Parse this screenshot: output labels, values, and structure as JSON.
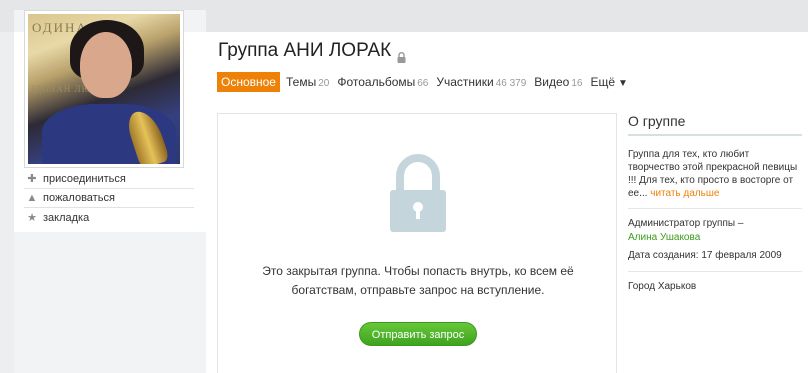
{
  "group": {
    "title": "Группа АНИ ЛОРАК",
    "avatar_banner": "ОДИНА",
    "avatar_banner2": "ЗДОЛАН        ЛЮД"
  },
  "sidebar": {
    "actions": [
      {
        "label": "присоединиться",
        "icon": "plus-icon"
      },
      {
        "label": "пожаловаться",
        "icon": "warning-icon"
      },
      {
        "label": "закладка",
        "icon": "star-icon"
      }
    ]
  },
  "tabs": [
    {
      "label": "Основное",
      "count": "",
      "active": true
    },
    {
      "label": "Темы",
      "count": "20"
    },
    {
      "label": "Фотоальбомы",
      "count": "66"
    },
    {
      "label": "Участники",
      "count": "46 379"
    },
    {
      "label": "Видео",
      "count": "16"
    },
    {
      "label": "Ещё",
      "count": ""
    }
  ],
  "locked": {
    "line1": "Это закрытая группа. Чтобы попасть внутрь, ко всем её",
    "line2": "богатствам, отправьте запрос на вступление.",
    "button": "Отправить запрос"
  },
  "about": {
    "title": "О группе",
    "description": "Группа для тех, кто любит творчество этой прекрасной певицы !!! Для тех, кто просто в восторге от ее...",
    "more": "читать дальше",
    "admin_label": "Администратор группы –",
    "admin_name": "Алина Ушакова",
    "created": "Дата создания: 17 февраля 2009",
    "city": "Город Харьков"
  },
  "colors": {
    "accent": "#ee8208",
    "button_green": "#4caf2a",
    "lock": "#c4d6dc"
  }
}
